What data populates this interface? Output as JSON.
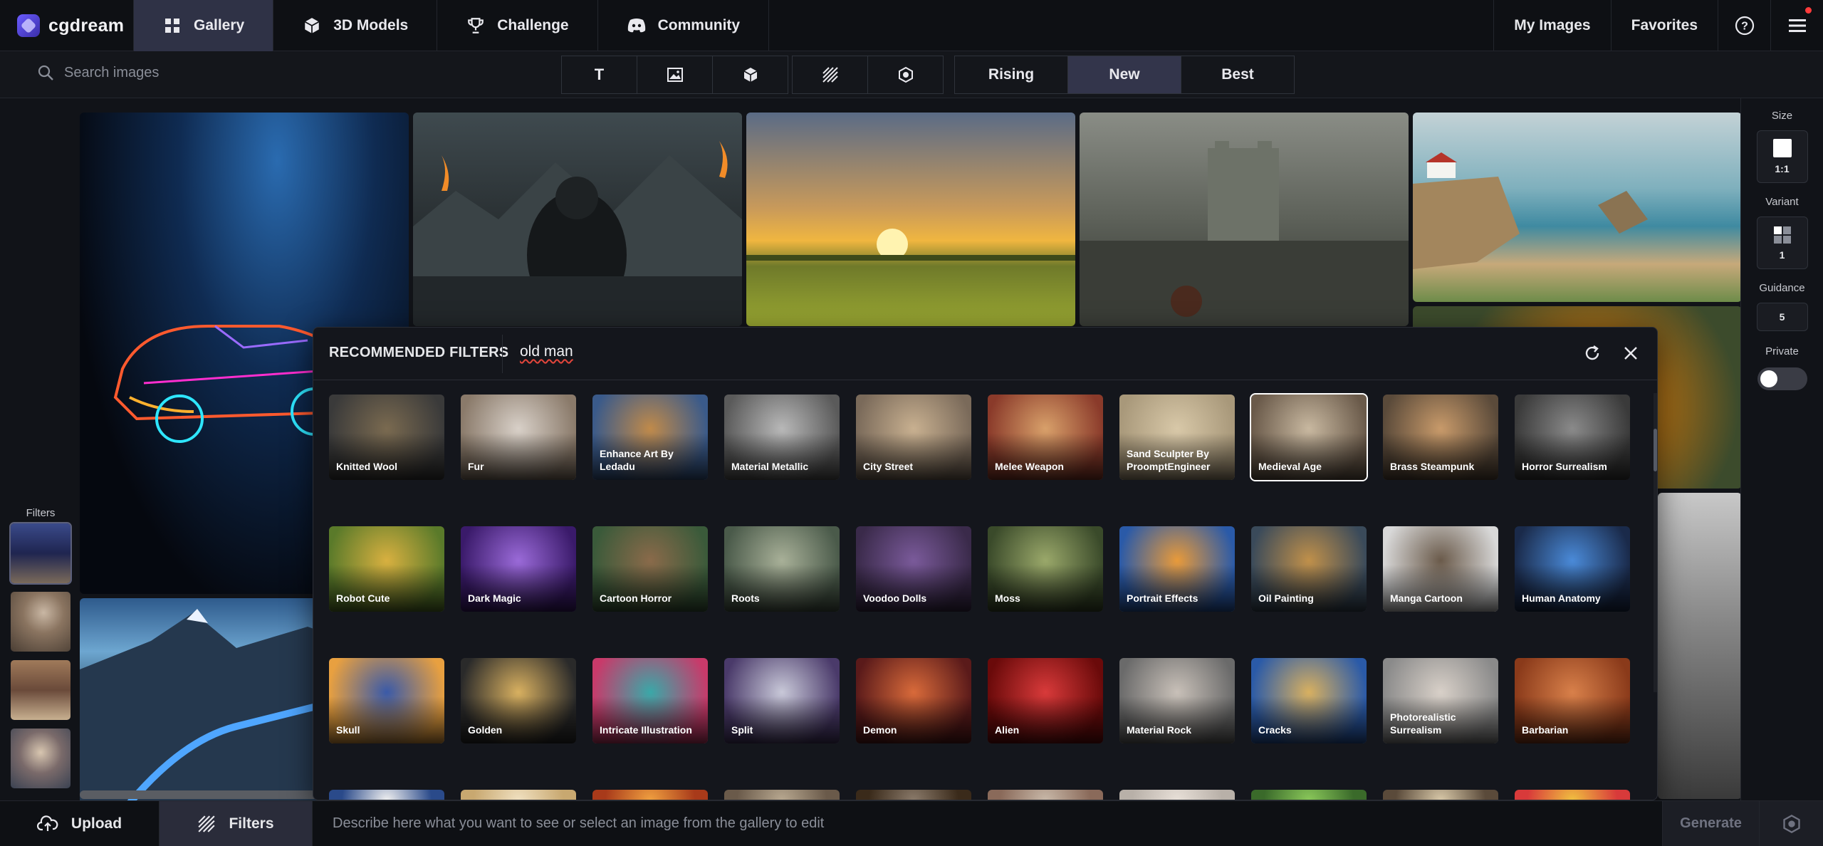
{
  "app": {
    "name": "cgdream"
  },
  "nav": {
    "tabs": [
      {
        "label": "Gallery",
        "icon": "grid-icon",
        "active": true
      },
      {
        "label": "3D Models",
        "icon": "cube-icon"
      },
      {
        "label": "Challenge",
        "icon": "trophy-icon"
      },
      {
        "label": "Community",
        "icon": "discord-icon"
      }
    ],
    "right": {
      "my_images": "My Images",
      "favorites": "Favorites",
      "help_icon": "help-circle-icon",
      "menu_icon": "hamburger-menu-icon"
    }
  },
  "search": {
    "placeholder": "Search images"
  },
  "type_filters": [
    "text-icon",
    "image-icon",
    "cube-icon",
    "texture-icon",
    "hdri-icon"
  ],
  "type_filters_text": [
    "T"
  ],
  "sort": {
    "options": [
      "Rising",
      "New",
      "Best"
    ],
    "selected": "New"
  },
  "left_filters": {
    "label": "Filters"
  },
  "right_panel": {
    "size_label": "Size",
    "size_value": "1:1",
    "variant_label": "Variant",
    "variant_value": "1",
    "guidance_label": "Guidance",
    "guidance_value": "5",
    "private_label": "Private",
    "private_on": false
  },
  "modal": {
    "title": "RECOMMENDED FILTERS",
    "search_value": "old man",
    "filters": [
      [
        "Knitted Wool",
        "Fur",
        "Enhance Art By Ledadu",
        "Material Metallic",
        "City Street",
        "Melee Weapon",
        "Sand Sculpter By ProomptEngineer",
        "Medieval Age",
        "Brass Steampunk",
        "Horror Surrealism"
      ],
      [
        "Robot Cute",
        "Dark Magic",
        "Cartoon Horror",
        "Roots",
        "Voodoo Dolls",
        "Moss",
        "Portrait Effects",
        "Oil Painting",
        "Manga Cartoon",
        "Human Anatomy"
      ],
      [
        "Skull",
        "Golden",
        "Intricate Illustration",
        "Split",
        "Demon",
        "Alien",
        "Material Rock",
        "Cracks",
        "Photorealistic Surrealism",
        "Barbarian"
      ],
      [
        "",
        "",
        "",
        "",
        "",
        "",
        "",
        "",
        "",
        ""
      ]
    ],
    "selected_filter": "Medieval Age"
  },
  "bottom": {
    "upload": "Upload",
    "filters": "Filters",
    "prompt_placeholder": "Describe here what you want to see or select an image from the gallery to edit",
    "generate": "Generate"
  }
}
